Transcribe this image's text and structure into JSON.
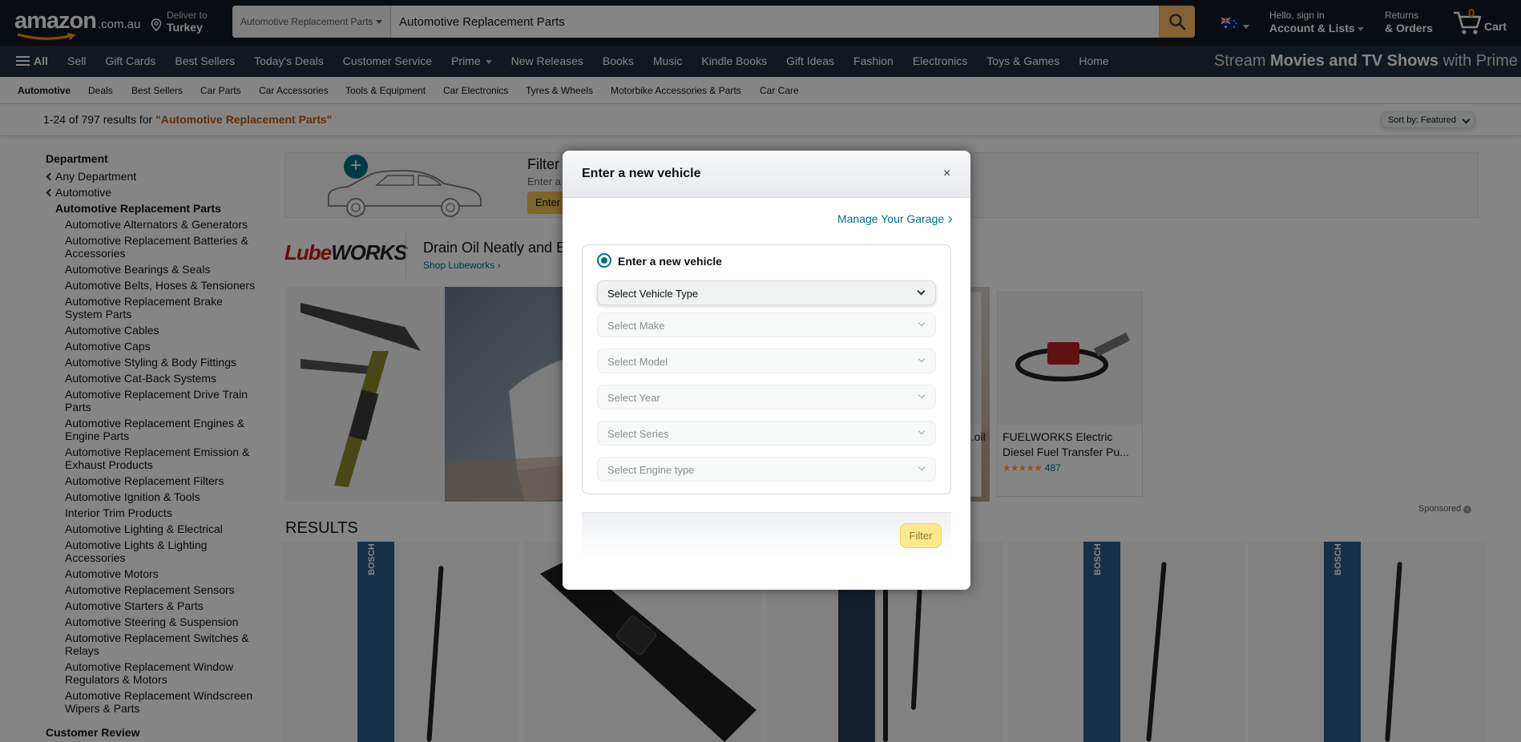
{
  "header": {
    "logo_text": "amazon",
    "logo_tld": ".com.au",
    "deliver_line1": "Deliver to",
    "deliver_line2": "Turkey",
    "search_category": "Automotive Replacement Parts",
    "search_value": "Automotive Replacement Parts",
    "account_line1": "Hello, sign in",
    "account_line2": "Account & Lists",
    "returns_line1": "Returns",
    "returns_line2": "& Orders",
    "cart_count": "0",
    "cart_label": "Cart"
  },
  "main_nav": {
    "all_label": "All",
    "links": [
      "Sell",
      "Gift Cards",
      "Best Sellers",
      "Today's Deals",
      "Customer Service",
      "Prime",
      "New Releases",
      "Books",
      "Music",
      "Kindle Books",
      "Gift Ideas",
      "Fashion",
      "Electronics",
      "Toys & Games",
      "Home"
    ],
    "promo_prefix": "Stream ",
    "promo_bold": "Movies and TV Shows",
    "promo_suffix": " with Prime"
  },
  "sub_nav": {
    "links": [
      "Automotive",
      "Deals",
      "Best Sellers",
      "Car Parts",
      "Car Accessories",
      "Tools & Equipment",
      "Car Electronics",
      "Tyres & Wheels",
      "Motorbike Accessories & Parts",
      "Car Care"
    ]
  },
  "results_bar": {
    "count_text": "1-24 of 797 results for ",
    "query": "\"Automotive Replacement Parts\"",
    "sort_label": "Sort by:",
    "sort_value": "Featured"
  },
  "sidebar": {
    "department_heading": "Department",
    "back_links": [
      "Any Department",
      "Automotive"
    ],
    "current": "Automotive Replacement Parts",
    "items": [
      "Automotive Alternators & Generators",
      "Automotive Replacement Batteries & Accessories",
      "Automotive Bearings & Seals",
      "Automotive Belts, Hoses & Tensioners",
      "Automotive Replacement Brake System Parts",
      "Automotive Cables",
      "Automotive Caps",
      "Automotive Styling & Body Fittings",
      "Automotive Cat-Back Systems",
      "Automotive Replacement Drive Train Parts",
      "Automotive Replacement Engines & Engine Parts",
      "Automotive Replacement Emission & Exhaust Products",
      "Automotive Replacement Filters",
      "Automotive Ignition & Tools",
      "Interior Trim Products",
      "Automotive Lighting & Electrical",
      "Automotive Lights & Lighting Accessories",
      "Automotive Motors",
      "Automotive Replacement Sensors",
      "Automotive Starters & Parts",
      "Automotive Steering & Suspension",
      "Automotive Replacement Switches & Relays",
      "Automotive Replacement Window Regulators & Motors",
      "Automotive Replacement Windscreen Wipers & Parts"
    ],
    "review_heading": "Customer Review"
  },
  "filter_banner": {
    "title": "Filter",
    "subtitle": "Enter a",
    "button": "Enter"
  },
  "sponsored_brand": {
    "logo_part1": "Lube",
    "logo_part2": "WORKS",
    "headline": "Drain Oil Neatly and E",
    "shop_link": "Shop Lubeworks ›",
    "products": [
      {
        "title": "...oil",
        "rating": ""
      },
      {
        "title": "FUELWORKS Electric Diesel Fuel Transfer Pu...",
        "stars": "★★★★★",
        "rating": "487"
      }
    ],
    "sponsored_label": "Sponsored"
  },
  "results_heading": "RESULTS",
  "modal": {
    "title": "Enter a new vehicle",
    "close": "×",
    "manage_garage": "Manage Your Garage",
    "radio_label": "Enter a new vehicle",
    "selects": [
      {
        "label": "Select Vehicle Type",
        "enabled": true
      },
      {
        "label": "Select Make",
        "enabled": false
      },
      {
        "label": "Select Model",
        "enabled": false
      },
      {
        "label": "Select Year",
        "enabled": false
      },
      {
        "label": "Select Series",
        "enabled": false
      },
      {
        "label": "Select Engine type",
        "enabled": false
      }
    ],
    "filter_button": "Filter"
  },
  "colors": {
    "nav_dark": "#131921",
    "nav_main": "#232f3e",
    "search_button": "#febd69",
    "link_teal": "#007185",
    "query_orange": "#c45500",
    "filter_disabled": "#fde98d"
  }
}
